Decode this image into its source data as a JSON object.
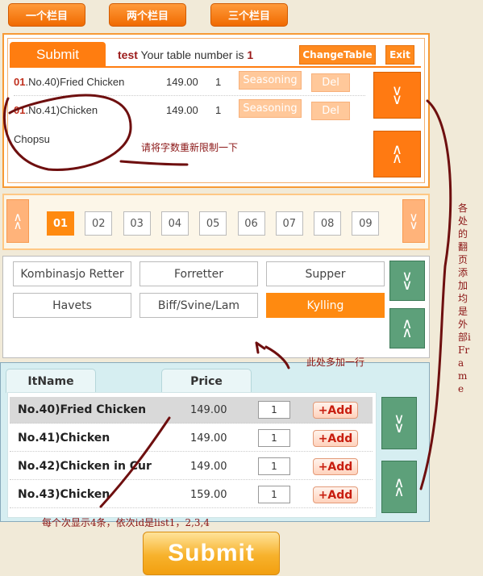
{
  "top_tabs": [
    "一个栏目",
    "两个栏目",
    "三个栏目"
  ],
  "order": {
    "submit_label": "Submit",
    "user": "test",
    "table_text": "Your table number is",
    "table_number": "1",
    "change_table": "ChangeTable",
    "exit": "Exit",
    "rows": [
      {
        "idx": "01",
        "name": ".No.40)Fried Chicken",
        "price": "149.00",
        "qty": "1",
        "seasoning": "Seasoning",
        "del": "Del"
      },
      {
        "idx": "01",
        "name": ".No.41)Chicken",
        "price": "149.00",
        "qty": "1",
        "seasoning": "Seasoning",
        "del": "Del",
        "wrap": "Chopsu"
      }
    ]
  },
  "annotations": {
    "limit_chars": "请将字数重新限制一下",
    "paging_iframe": "各处的翻页添加均是外部iFrame",
    "add_row": "此处多加一行",
    "show_four": "每个次显示4条，依次id是list1，2,3,4"
  },
  "pager": {
    "pages": [
      "01",
      "02",
      "03",
      "04",
      "05",
      "06",
      "07",
      "08",
      "09"
    ],
    "active": "01"
  },
  "categories": [
    {
      "label": "Kombinasjo Retter",
      "active": false
    },
    {
      "label": "Forretter",
      "active": false
    },
    {
      "label": "Supper",
      "active": false
    },
    {
      "label": "Havets",
      "active": false
    },
    {
      "label": "Biff/Svine/Lam",
      "active": false
    },
    {
      "label": "Kylling",
      "active": true
    }
  ],
  "items": {
    "col_name": "ItName",
    "col_price": "Price",
    "add_label": "Add",
    "rows": [
      {
        "name": "No.40)Fried Chicken",
        "price": "149.00",
        "qty": "1",
        "selected": true
      },
      {
        "name": "No.41)Chicken",
        "price": "149.00",
        "qty": "1",
        "selected": false
      },
      {
        "name": "No.42)Chicken in Cur",
        "price": "149.00",
        "qty": "1",
        "selected": false
      },
      {
        "name": "No.43)Chicken",
        "price": "159.00",
        "qty": "1",
        "selected": false
      }
    ]
  },
  "submit_big": "Submit",
  "colors": {
    "accent": "#ff7d10",
    "green": "#5da07a",
    "annotation": "#8a1414"
  }
}
